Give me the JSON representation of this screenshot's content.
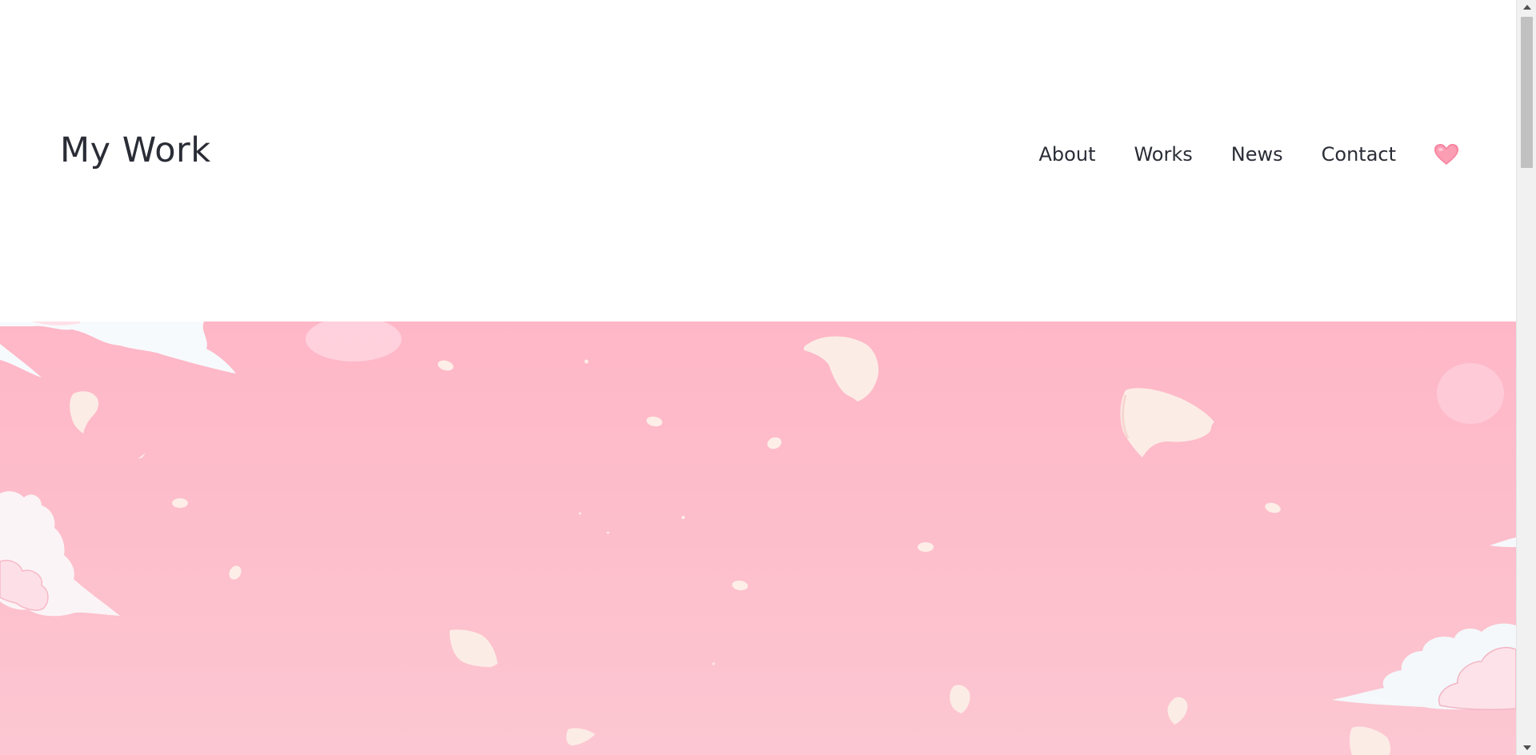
{
  "header": {
    "site_title": "My Work",
    "nav": [
      {
        "label": "About"
      },
      {
        "label": "Works"
      },
      {
        "label": "News"
      },
      {
        "label": "Contact"
      }
    ],
    "heart_icon": "heart-icon"
  },
  "hero": {
    "background_colors": [
      "#feb7c7",
      "#fcc7d2"
    ],
    "decoration": "cherry-blossom-petals-and-clouds-illustration"
  },
  "colors": {
    "text": "#2a2d36",
    "heart": "#f7839f",
    "petal": "#fdeee8",
    "cloud": "#f6f9fc"
  }
}
